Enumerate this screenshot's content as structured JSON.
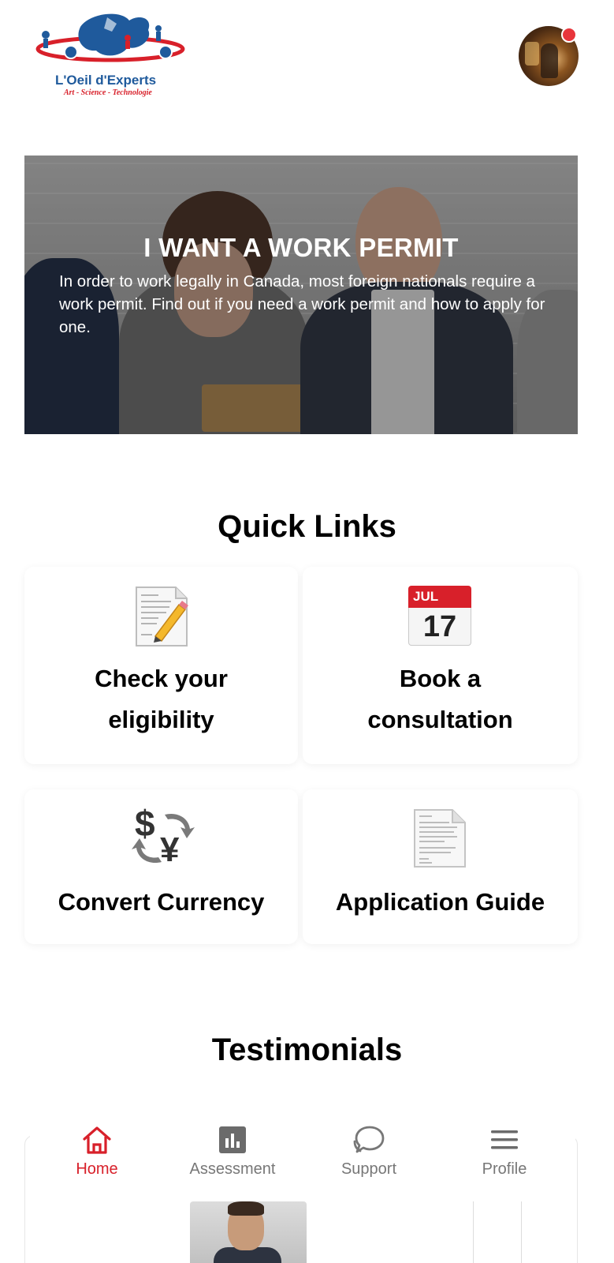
{
  "header": {
    "logo_name": "L'Oeil d'Experts",
    "logo_tagline": "Art - Science - Technologie",
    "avatar_icon": "user-avatar",
    "notification_dot_color": "#e8353b"
  },
  "hero": {
    "title": "I WANT A WORK PERMIT",
    "description": "In order to work legally in Canada, most foreign nationals require a work permit. Find out if you need a work permit and how to apply for one."
  },
  "quick_links": {
    "title": "Quick Links",
    "items": [
      {
        "label_line1": "Check your",
        "label_line2": "eligibility",
        "icon": "document-pencil-icon"
      },
      {
        "label_line1": "Book a",
        "label_line2": "consultation",
        "icon": "calendar-icon",
        "calendar_month": "JUL",
        "calendar_day": "17"
      },
      {
        "label": "Convert Currency",
        "icon": "currency-exchange-icon",
        "symbol_top": "$",
        "symbol_bottom": "¥"
      },
      {
        "label": "Application Guide",
        "icon": "document-icon"
      }
    ]
  },
  "testimonials": {
    "title": "Testimonials"
  },
  "bottom_nav": {
    "items": [
      {
        "label": "Home",
        "icon": "home-icon",
        "active": true
      },
      {
        "label": "Assessment",
        "icon": "bar-chart-icon",
        "active": false
      },
      {
        "label": "Support",
        "icon": "chat-bubble-icon",
        "active": false
      },
      {
        "label": "Profile",
        "icon": "menu-icon",
        "active": false
      }
    ]
  },
  "colors": {
    "accent": "#d8202a",
    "brand_blue": "#1f5a9c",
    "inactive_nav": "#777777"
  }
}
